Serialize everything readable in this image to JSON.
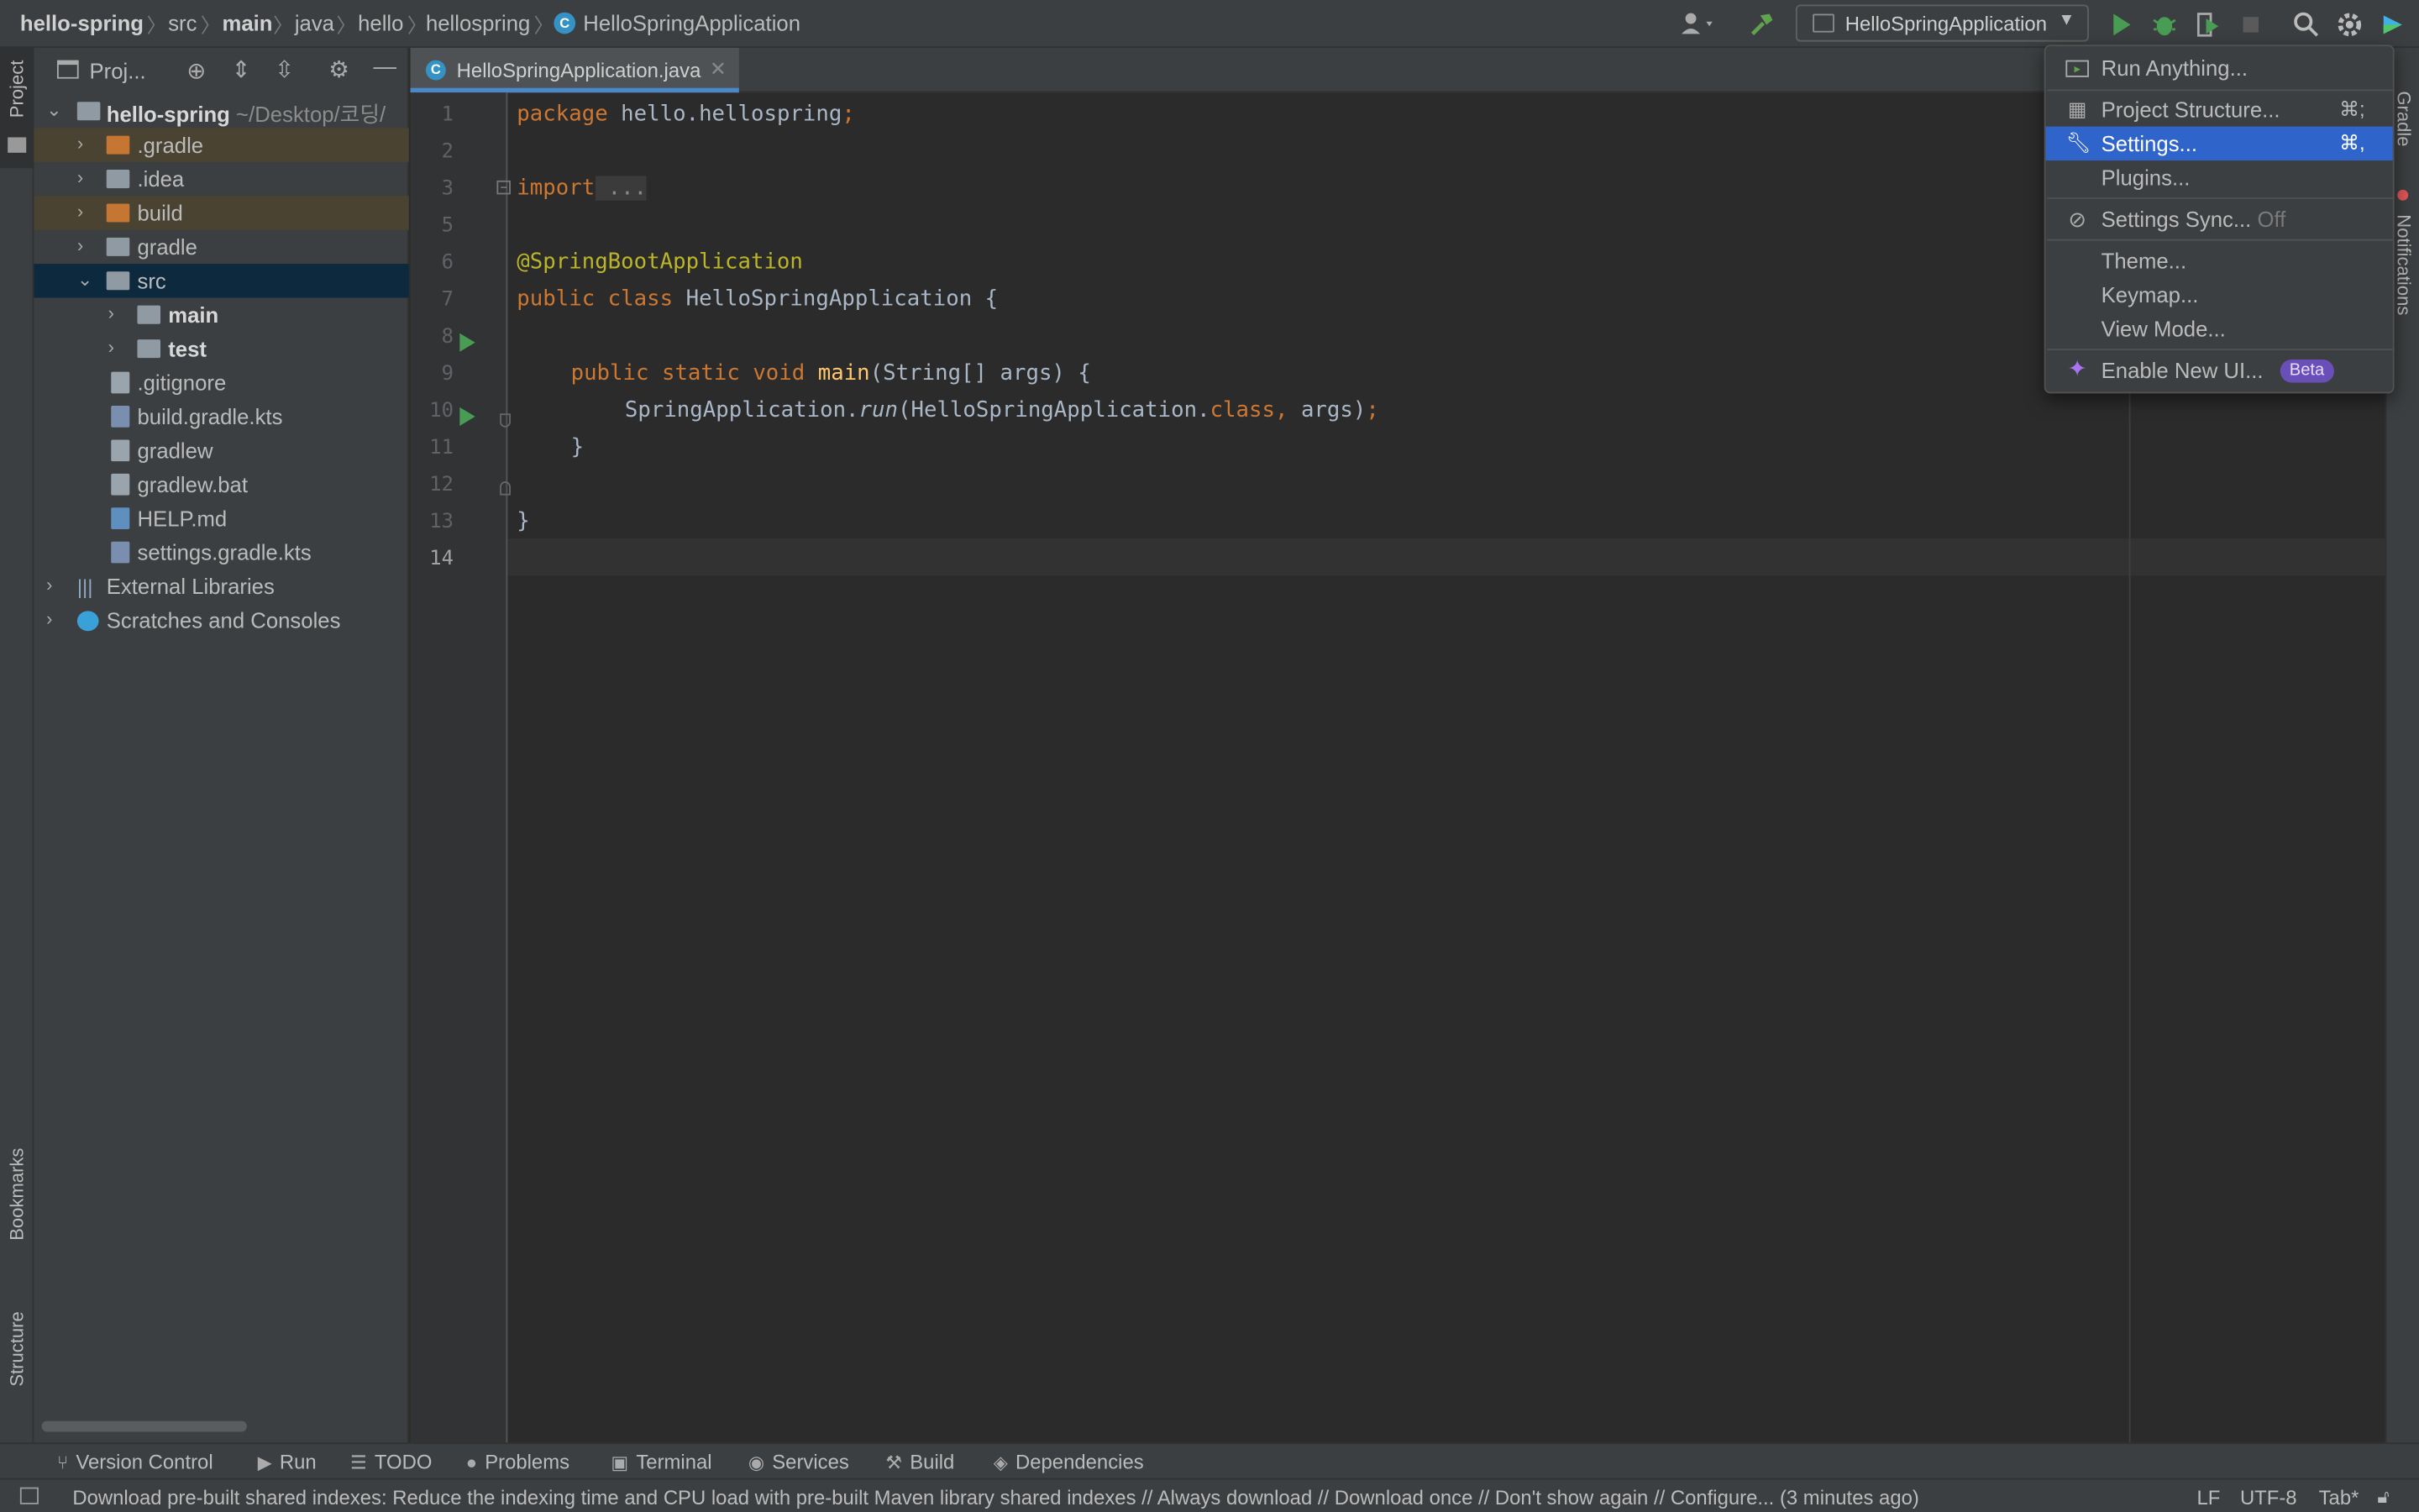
{
  "breadcrumb": {
    "items": [
      "hello-spring",
      "src",
      "main",
      "java",
      "hello",
      "hellospring",
      "HelloSpringApplication"
    ]
  },
  "toolbar": {
    "run_config": "HelloSpringApplication"
  },
  "left_strip": {
    "project": "Project",
    "bookmarks": "Bookmarks",
    "structure": "Structure"
  },
  "right_strip": {
    "gradle": "Gradle",
    "notifications": "Notifications"
  },
  "project_panel": {
    "title": "Proj...",
    "tree": [
      {
        "label": "hello-spring",
        "sub": "~/Desktop/코딩/"
      },
      {
        "label": ".gradle"
      },
      {
        "label": ".idea"
      },
      {
        "label": "build"
      },
      {
        "label": "gradle"
      },
      {
        "label": "src"
      },
      {
        "label": "main"
      },
      {
        "label": "test"
      },
      {
        "label": ".gitignore"
      },
      {
        "label": "build.gradle.kts"
      },
      {
        "label": "gradlew"
      },
      {
        "label": "gradlew.bat"
      },
      {
        "label": "HELP.md"
      },
      {
        "label": "settings.gradle.kts"
      },
      {
        "label": "External Libraries"
      },
      {
        "label": "Scratches and Consoles"
      }
    ]
  },
  "editor": {
    "tab": "HelloSpringApplication.java",
    "line_numbers": [
      "1",
      "2",
      "3",
      "5",
      "6",
      "7",
      "8",
      "9",
      "10",
      "11",
      "12",
      "13",
      "14"
    ],
    "code": {
      "l1_kw": "package",
      "l1_rest": " hello.hellospring",
      "l1_semi": ";",
      "l3_kw": "import",
      "l3_rest": " ...",
      "l6": "@SpringBootApplication",
      "l7_kw": "public class",
      "l7_rest": " HelloSpringApplication {",
      "l9_kw": "public static void",
      "l9_fn": " main",
      "l9_rest": "(String[] args) {",
      "l10_a": "SpringApplication.",
      "l10_run": "run",
      "l10_b": "(HelloSpringApplication.",
      "l10_class": "class,",
      "l10_c": " args)",
      "l10_semi": ";",
      "l11": "}",
      "l13": "}"
    }
  },
  "menu": {
    "items": [
      {
        "label": "Run Anything...",
        "shortcut": ""
      },
      {
        "label": "Project Structure...",
        "shortcut": "⌘;"
      },
      {
        "label": "Settings...",
        "shortcut": "⌘,"
      },
      {
        "label": "Plugins...",
        "shortcut": ""
      },
      {
        "label": "Settings Sync...",
        "extra": "Off"
      },
      {
        "label": "Theme..."
      },
      {
        "label": "Keymap..."
      },
      {
        "label": "View Mode..."
      },
      {
        "label": "Enable New UI...",
        "badge": "Beta"
      }
    ]
  },
  "bottom_tools": [
    "Version Control",
    "Run",
    "TODO",
    "Problems",
    "Terminal",
    "Services",
    "Build",
    "Dependencies"
  ],
  "status": {
    "message": "Download pre-built shared indexes: Reduce the indexing time and CPU load with pre-built Maven library shared indexes // Always download // Download once // Don't show again // Configure... (3 minutes ago)",
    "line_sep": "LF",
    "encoding": "UTF-8",
    "indent": "Tab*"
  },
  "colors": {
    "accent": "#2f65ca",
    "run_green": "#499c54",
    "keyword": "#cc7832",
    "annotation": "#bbb529"
  }
}
